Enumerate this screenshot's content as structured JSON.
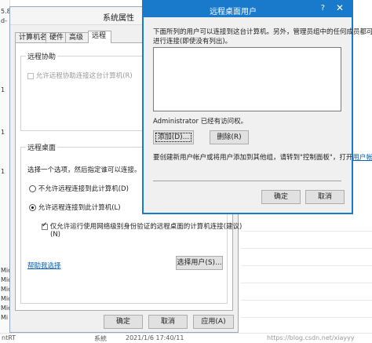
{
  "background": {
    "left_fragments": [
      "5.8",
      "d-",
      "1",
      "1",
      "1",
      "Mic",
      "Mic",
      "Mic",
      "Mic",
      "Mic",
      "Mi"
    ],
    "bottom": {
      "col1": "ntRT",
      "col2": "系統",
      "col3": "2021/1/6 17:40/11"
    },
    "watermark": "https://blog.csdn.net/xiayyy"
  },
  "sysprop": {
    "title": "系统属性",
    "tabs": [
      "计算机名",
      "硬件",
      "高级",
      "远程"
    ],
    "remote_assist": {
      "group_label": "远程协助",
      "allow_label": "允许远程协助连接这台计算机(R)"
    },
    "remote_desktop": {
      "group_label": "远程桌面",
      "instruction": "选择一个选项，然后指定谁可以连接。",
      "option_deny": "不允许远程连接到此计算机(D)",
      "option_allow": "允许远程连接到此计算机(L)",
      "nla_line1": "仅允许运行使用网络级别身份验证的远程桌面的计算机连接(建议)",
      "nla_line2": "(N)",
      "help_link": "帮助我选择",
      "select_users_button": "选择用户(S)..."
    },
    "buttons": {
      "ok": "确定",
      "cancel": "取消",
      "apply": "应用(A)"
    }
  },
  "rdu": {
    "title": "远程桌面用户",
    "help": "?",
    "close": "✕",
    "desc_line1": "下面所列的用户可以连接到这台计算机。另外，管理员组中的任何成员都可以",
    "desc_line2": "进行连接(即使没有列出)。",
    "users": [],
    "access_status": "Administrator 已经有访问权。",
    "add_button": "添加(D)...",
    "remove_button": "删除(R)",
    "create_text": "要创建新用户帐户或将用户添加到其他组，请转到\"控制面板\"，打开",
    "create_link": "用户帐户",
    "create_text2": "。",
    "ok": "确定",
    "cancel": "取消"
  }
}
